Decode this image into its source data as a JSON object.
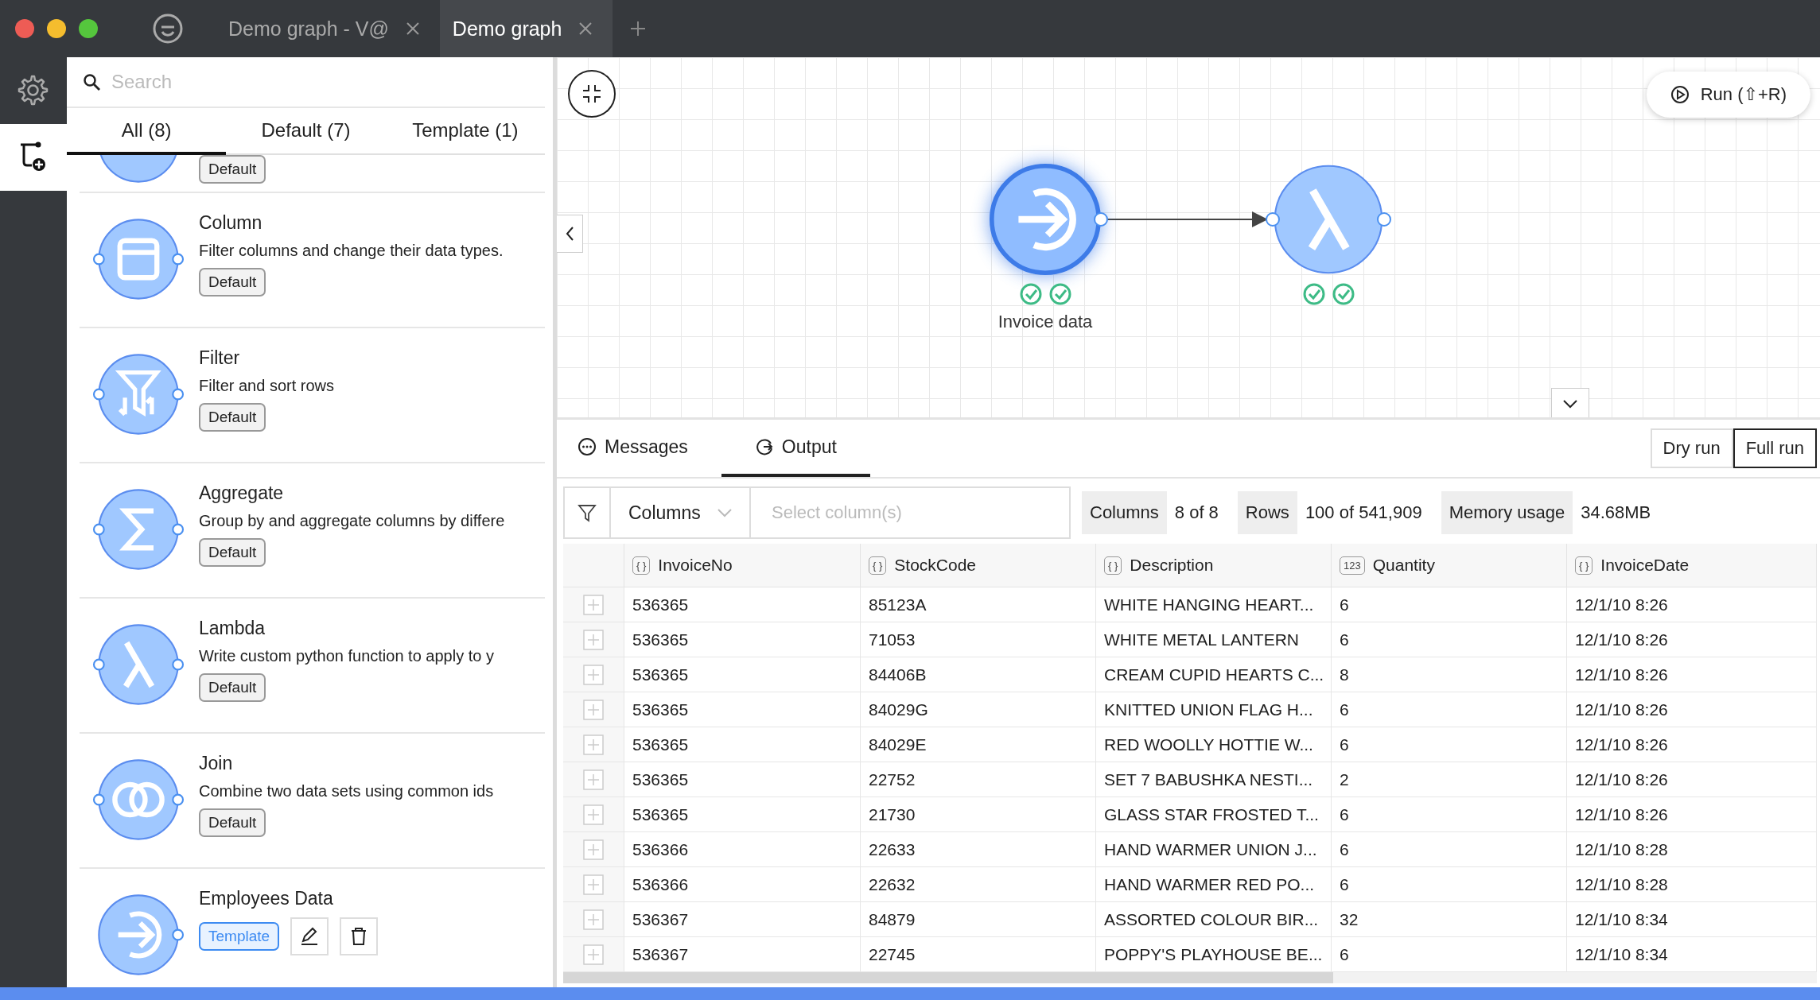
{
  "window": {
    "tabs": [
      {
        "title": "Demo graph - V@",
        "selected": false
      },
      {
        "title": "Demo graph",
        "selected": true
      }
    ]
  },
  "rail": [
    {
      "kind": "settings",
      "selected": false
    },
    {
      "kind": "add-node",
      "selected": true
    }
  ],
  "sidebar": {
    "search": {
      "placeholder": "Search"
    },
    "tabs": [
      {
        "label": "All (8)",
        "selected": true
      },
      {
        "label": "Default (7)",
        "selected": false
      },
      {
        "label": "Template (1)",
        "selected": false
      }
    ],
    "items": [
      {
        "kind": "unknown",
        "tag": {
          "label": "Default",
          "kind": "default"
        }
      },
      {
        "kind": "column",
        "title": "Column",
        "description": "Filter columns and change their data types.",
        "tag": {
          "label": "Default",
          "kind": "default"
        }
      },
      {
        "kind": "filter",
        "title": "Filter",
        "description": "Filter and sort rows",
        "tag": {
          "label": "Default",
          "kind": "default"
        }
      },
      {
        "kind": "aggregate",
        "title": "Aggregate",
        "description": "Group by and aggregate columns by differe",
        "tag": {
          "label": "Default",
          "kind": "default"
        }
      },
      {
        "kind": "lambda",
        "title": "Lambda",
        "description": "Write custom python function to apply to y",
        "tag": {
          "label": "Default",
          "kind": "default"
        }
      },
      {
        "kind": "join",
        "title": "Join",
        "description": "Combine two data sets using common ids",
        "tag": {
          "label": "Default",
          "kind": "default"
        }
      },
      {
        "kind": "input",
        "title": "Employees Data",
        "tag": {
          "label": "Template",
          "kind": "template"
        },
        "editable": true
      }
    ]
  },
  "canvas": {
    "run_button": "Run (⇧+R)",
    "nodes": [
      {
        "kind": "input",
        "label": "Invoice data",
        "selected": true,
        "checks": [
          {
            "passed": true
          },
          {
            "passed": true
          }
        ]
      },
      {
        "kind": "lambda",
        "selected": false,
        "checks": [
          {
            "passed": true
          },
          {
            "passed": true
          }
        ]
      }
    ]
  },
  "output": {
    "tabs": [
      {
        "label": "Messages",
        "kind": "messages",
        "selected": false
      },
      {
        "label": "Output",
        "kind": "output",
        "selected": true
      }
    ],
    "modes": [
      {
        "label": "Dry run",
        "selected": false
      },
      {
        "label": "Full run",
        "selected": true
      }
    ],
    "filter": {
      "dropdown": "Columns",
      "placeholder": "Select column(s)"
    },
    "stats": [
      {
        "label": "Columns",
        "value": "8 of 8"
      },
      {
        "label": "Rows",
        "value": "100 of 541,909"
      },
      {
        "label": "Memory usage",
        "value": "34.68MB"
      }
    ],
    "table": {
      "columns": [
        {
          "type": "{ }",
          "name": "InvoiceNo"
        },
        {
          "type": "{ }",
          "name": "StockCode"
        },
        {
          "type": "{ }",
          "name": "Description"
        },
        {
          "type": "123",
          "name": "Quantity"
        },
        {
          "type": "{ }",
          "name": "InvoiceDate"
        }
      ],
      "rows": [
        [
          "536365",
          "85123A",
          "WHITE HANGING HEART...",
          "6",
          "12/1/10 8:26"
        ],
        [
          "536365",
          "71053",
          "WHITE METAL LANTERN",
          "6",
          "12/1/10 8:26"
        ],
        [
          "536365",
          "84406B",
          "CREAM CUPID HEARTS C...",
          "8",
          "12/1/10 8:26"
        ],
        [
          "536365",
          "84029G",
          "KNITTED UNION FLAG H...",
          "6",
          "12/1/10 8:26"
        ],
        [
          "536365",
          "84029E",
          "RED WOOLLY HOTTIE W...",
          "6",
          "12/1/10 8:26"
        ],
        [
          "536365",
          "22752",
          "SET 7 BABUSHKA NESTI...",
          "2",
          "12/1/10 8:26"
        ],
        [
          "536365",
          "21730",
          "GLASS STAR FROSTED T...",
          "6",
          "12/1/10 8:26"
        ],
        [
          "536366",
          "22633",
          "HAND WARMER UNION J...",
          "6",
          "12/1/10 8:28"
        ],
        [
          "536366",
          "22632",
          "HAND WARMER RED PO...",
          "6",
          "12/1/10 8:28"
        ],
        [
          "536367",
          "84879",
          "ASSORTED COLOUR BIR...",
          "32",
          "12/1/10 8:34"
        ],
        [
          "536367",
          "22745",
          "POPPY'S PLAYHOUSE BE...",
          "6",
          "12/1/10 8:34"
        ]
      ]
    }
  }
}
